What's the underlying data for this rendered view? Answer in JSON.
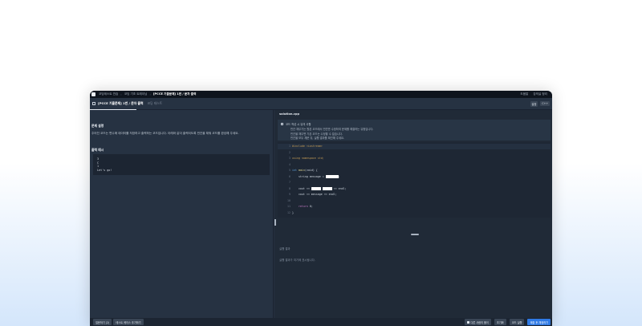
{
  "topbar": {
    "crumbs": [
      "코딩테스트 연습",
      "코딩 기초 트레이닝",
      "[PCCE 기출문제] 1번 / 문자 출력"
    ],
    "right": [
      "도움말",
      "강의실 정리"
    ]
  },
  "tabbar": {
    "title": "[PCCE 기출문제] 1번 / 문자 출력",
    "subtitle": "코딩 테스트",
    "lang": "C++",
    "setting": "설정"
  },
  "left": {
    "problem_title": "문제 설명",
    "problem_desc": "주어진 코드는 변수에 데이터를 저장하고 출력하는 코드입니다. 아래와 같이 출력되도록 빈칸을 채워 코드를 완성해 주세요.",
    "output_title": "출력 예시",
    "output_lines": [
      "3",
      "C",
      "1",
      "Let's go!"
    ]
  },
  "right": {
    "filename": "solution.cpp",
    "hint_header": "코드 작성 시 유의 사항",
    "hint_lines": [
      "빈칸 채우기는 원본 코드에서 빈칸만 수정하여 문제를 해결하는 유형입니다.",
      "빈칸을 채우면 기존 코드는 수정할 수 없습니다.",
      "빈칸을 모두 채운 뒤, 실행 결과를 확인해 주세요."
    ],
    "code_lines": [
      {
        "no": "1",
        "parts": [
          {
            "t": "#include <iostream>",
            "c": "kw-inc"
          }
        ]
      },
      {
        "no": "2",
        "parts": []
      },
      {
        "no": "3",
        "parts": [
          {
            "t": "using namespace std;",
            "c": "kw-using"
          }
        ]
      },
      {
        "no": "4",
        "parts": []
      },
      {
        "no": "5",
        "parts": [
          {
            "t": "int ",
            "c": "kw-type"
          },
          {
            "t": "main",
            "c": "kw-fn"
          },
          {
            "t": "(void) {",
            "c": ""
          }
        ]
      },
      {
        "no": "6",
        "parts": [
          {
            "t": "    string message = ",
            "c": ""
          },
          {
            "t": "        ",
            "c": "kw-str"
          },
          {
            "t": ";",
            "c": ""
          }
        ]
      },
      {
        "no": "7",
        "parts": []
      },
      {
        "no": "8",
        "parts": [
          {
            "t": "    cout << ",
            "c": ""
          },
          {
            "t": "      ",
            "c": "kw-str"
          },
          {
            "t": " ",
            "c": ""
          },
          {
            "t": "      ",
            "c": "kw-str"
          },
          {
            "t": " << endl;",
            "c": ""
          }
        ]
      },
      {
        "no": "9",
        "parts": [
          {
            "t": "    cout << message << endl;",
            "c": ""
          }
        ]
      },
      {
        "no": "10",
        "parts": []
      },
      {
        "no": "11",
        "parts": [
          {
            "t": "    return ",
            "c": "kw-ret"
          },
          {
            "t": "0;",
            "c": ""
          }
        ]
      },
      {
        "no": "12",
        "parts": [
          {
            "t": "}",
            "c": ""
          }
        ]
      }
    ],
    "result_title": "실행 결과",
    "result_body": "실행 결과가 여기에 표시됩니다."
  },
  "bottombar": {
    "left": [
      "질문하기 (2)",
      "테스트 케이스 추가하기"
    ],
    "help": "다른 사람의 풀이",
    "reset": "초기화",
    "run": "코드 실행",
    "submit": "제출 후 채점하기"
  }
}
